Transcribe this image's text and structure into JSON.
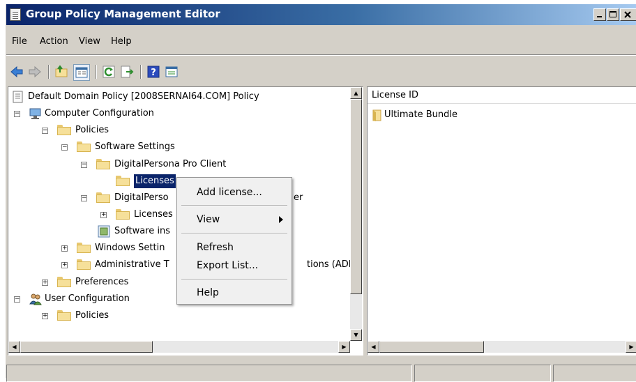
{
  "window": {
    "title": "Group Policy Management Editor"
  },
  "menubar": {
    "items": [
      "File",
      "Action",
      "View",
      "Help"
    ]
  },
  "toolbar": {
    "icons": [
      "back-icon",
      "forward-icon",
      "up-folder-icon",
      "show-hide-tree-icon",
      "refresh-icon",
      "export-list-icon",
      "help-icon",
      "properties-icon"
    ]
  },
  "tree": {
    "root": "Default Domain Policy [2008SERNAI64.COM] Policy",
    "computer_config": "Computer Configuration",
    "policies": "Policies",
    "software_settings": "Software Settings",
    "dp_pro_client": "DigitalPersona Pro Client",
    "licenses_selected": "Licenses",
    "dp_pro_server_partial": "DigitalPerso",
    "dp_pro_server_tail": "er",
    "licenses_2": "Licenses",
    "software_installation_partial": "Software ins",
    "windows_settings_partial": "Windows Settin",
    "admin_templates_partial": "Administrative T",
    "admin_templates_tail": "tions (ADM",
    "preferences": "Preferences",
    "user_config": "User Configuration",
    "user_policies": "Policies"
  },
  "details": {
    "column_header": "License ID",
    "items": [
      "Ultimate Bundle"
    ]
  },
  "context_menu": {
    "add_license": "Add license...",
    "view": "View",
    "refresh": "Refresh",
    "export_list": "Export List...",
    "help": "Help"
  },
  "colors": {
    "titlebar": "#0a246a",
    "selection": "#0a246a",
    "folder": "#f6e09a"
  }
}
